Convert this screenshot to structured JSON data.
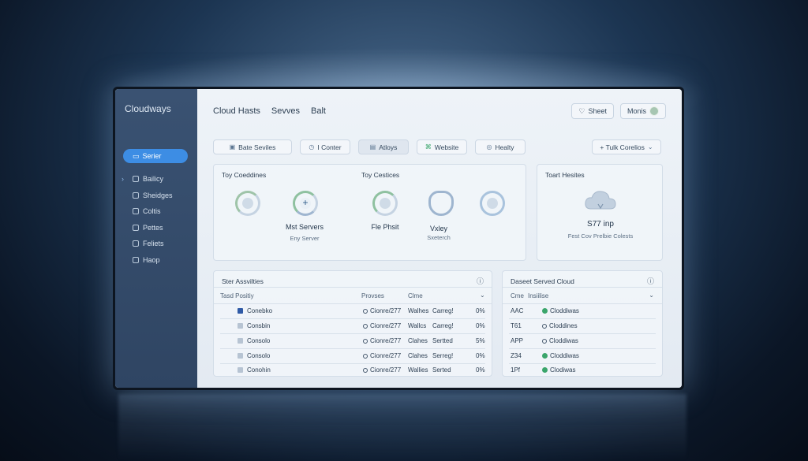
{
  "sidebar": {
    "brand": "Cloudways",
    "primary_button": "Serier",
    "items": [
      {
        "label": "Bailicy",
        "icon": "doc-icon"
      },
      {
        "label": "Sheidges",
        "icon": "stack-icon"
      },
      {
        "label": "Coltis",
        "icon": "link-icon"
      },
      {
        "label": "Pettes",
        "icon": "clip-icon"
      },
      {
        "label": "Feliets",
        "icon": "pin-icon"
      },
      {
        "label": "Haop",
        "icon": "grid-icon"
      }
    ]
  },
  "header": {
    "tabs": [
      "Cloud Hasts",
      "Sevves",
      "Balt"
    ],
    "search_label": "Sheet",
    "profile_label": "Monis"
  },
  "toolbar": {
    "chips": [
      {
        "label": "Bate Seviles",
        "icon": "calendar-icon"
      },
      {
        "label": "I Conter",
        "icon": "clock-icon"
      },
      {
        "label": "Atloys",
        "icon": "lock-icon"
      },
      {
        "label": "Website",
        "icon": "code-icon"
      },
      {
        "label": "Healty",
        "icon": "gauge-icon"
      },
      {
        "label": "+ Tulk Corelios",
        "icon": "chevron-down-icon"
      }
    ]
  },
  "overview": {
    "left_title": "Toy Coeddines",
    "right_title": "Toy Cestices",
    "stats": [
      {
        "label": "Mst Servers",
        "sub": "Eny Server"
      },
      {
        "label": "Fle Phsit",
        "sub": ""
      },
      {
        "label": "Vxley",
        "sub": "Sxeterch"
      }
    ]
  },
  "side_panel": {
    "title": "Toart Hesites",
    "value": "S77 inp",
    "sub": "Fest Cov Prelbie Colests"
  },
  "activity": {
    "title": "Ster Assvilties",
    "columns": [
      "Tasd Positiy",
      "Provses",
      "Clme"
    ],
    "rows": [
      {
        "name": "Conebko",
        "process": "Cionre/277",
        "c1": "Walhes",
        "c2": "Carreg!",
        "pct": "0%",
        "checked": true
      },
      {
        "name": "Consbin",
        "process": "Cionre/277",
        "c1": "Wallcs",
        "c2": "Carreg!",
        "pct": "0%",
        "checked": false
      },
      {
        "name": "Consolo",
        "process": "Cionre/277",
        "c1": "Clahes",
        "c2": "Sertted",
        "pct": "5%",
        "checked": false
      },
      {
        "name": "Consolo",
        "process": "Cionre/277",
        "c1": "Clahes",
        "c2": "Serreg!",
        "pct": "0%",
        "checked": false
      },
      {
        "name": "Conohin",
        "process": "Cionre/277",
        "c1": "Wallies",
        "c2": "Serted",
        "pct": "0%",
        "checked": false
      }
    ]
  },
  "cloud": {
    "title": "Daseet Served Cloud",
    "columns": [
      "Cme",
      "Insiilise"
    ],
    "rows": [
      {
        "code": "AAC",
        "name": "Cloddiwas",
        "status": "ok"
      },
      {
        "code": "T61",
        "name": "Cloddines",
        "status": "neutral"
      },
      {
        "code": "APP",
        "name": "Cloddiwas",
        "status": "neutral"
      },
      {
        "code": "Z34",
        "name": "Cloddiwas",
        "status": "ok"
      },
      {
        "code": "1Pf",
        "name": "Clodiwas",
        "status": "ok"
      }
    ]
  },
  "colors": {
    "accent": "#3d8de4",
    "sidebar": "#34496a",
    "ok": "#3aa56b"
  }
}
